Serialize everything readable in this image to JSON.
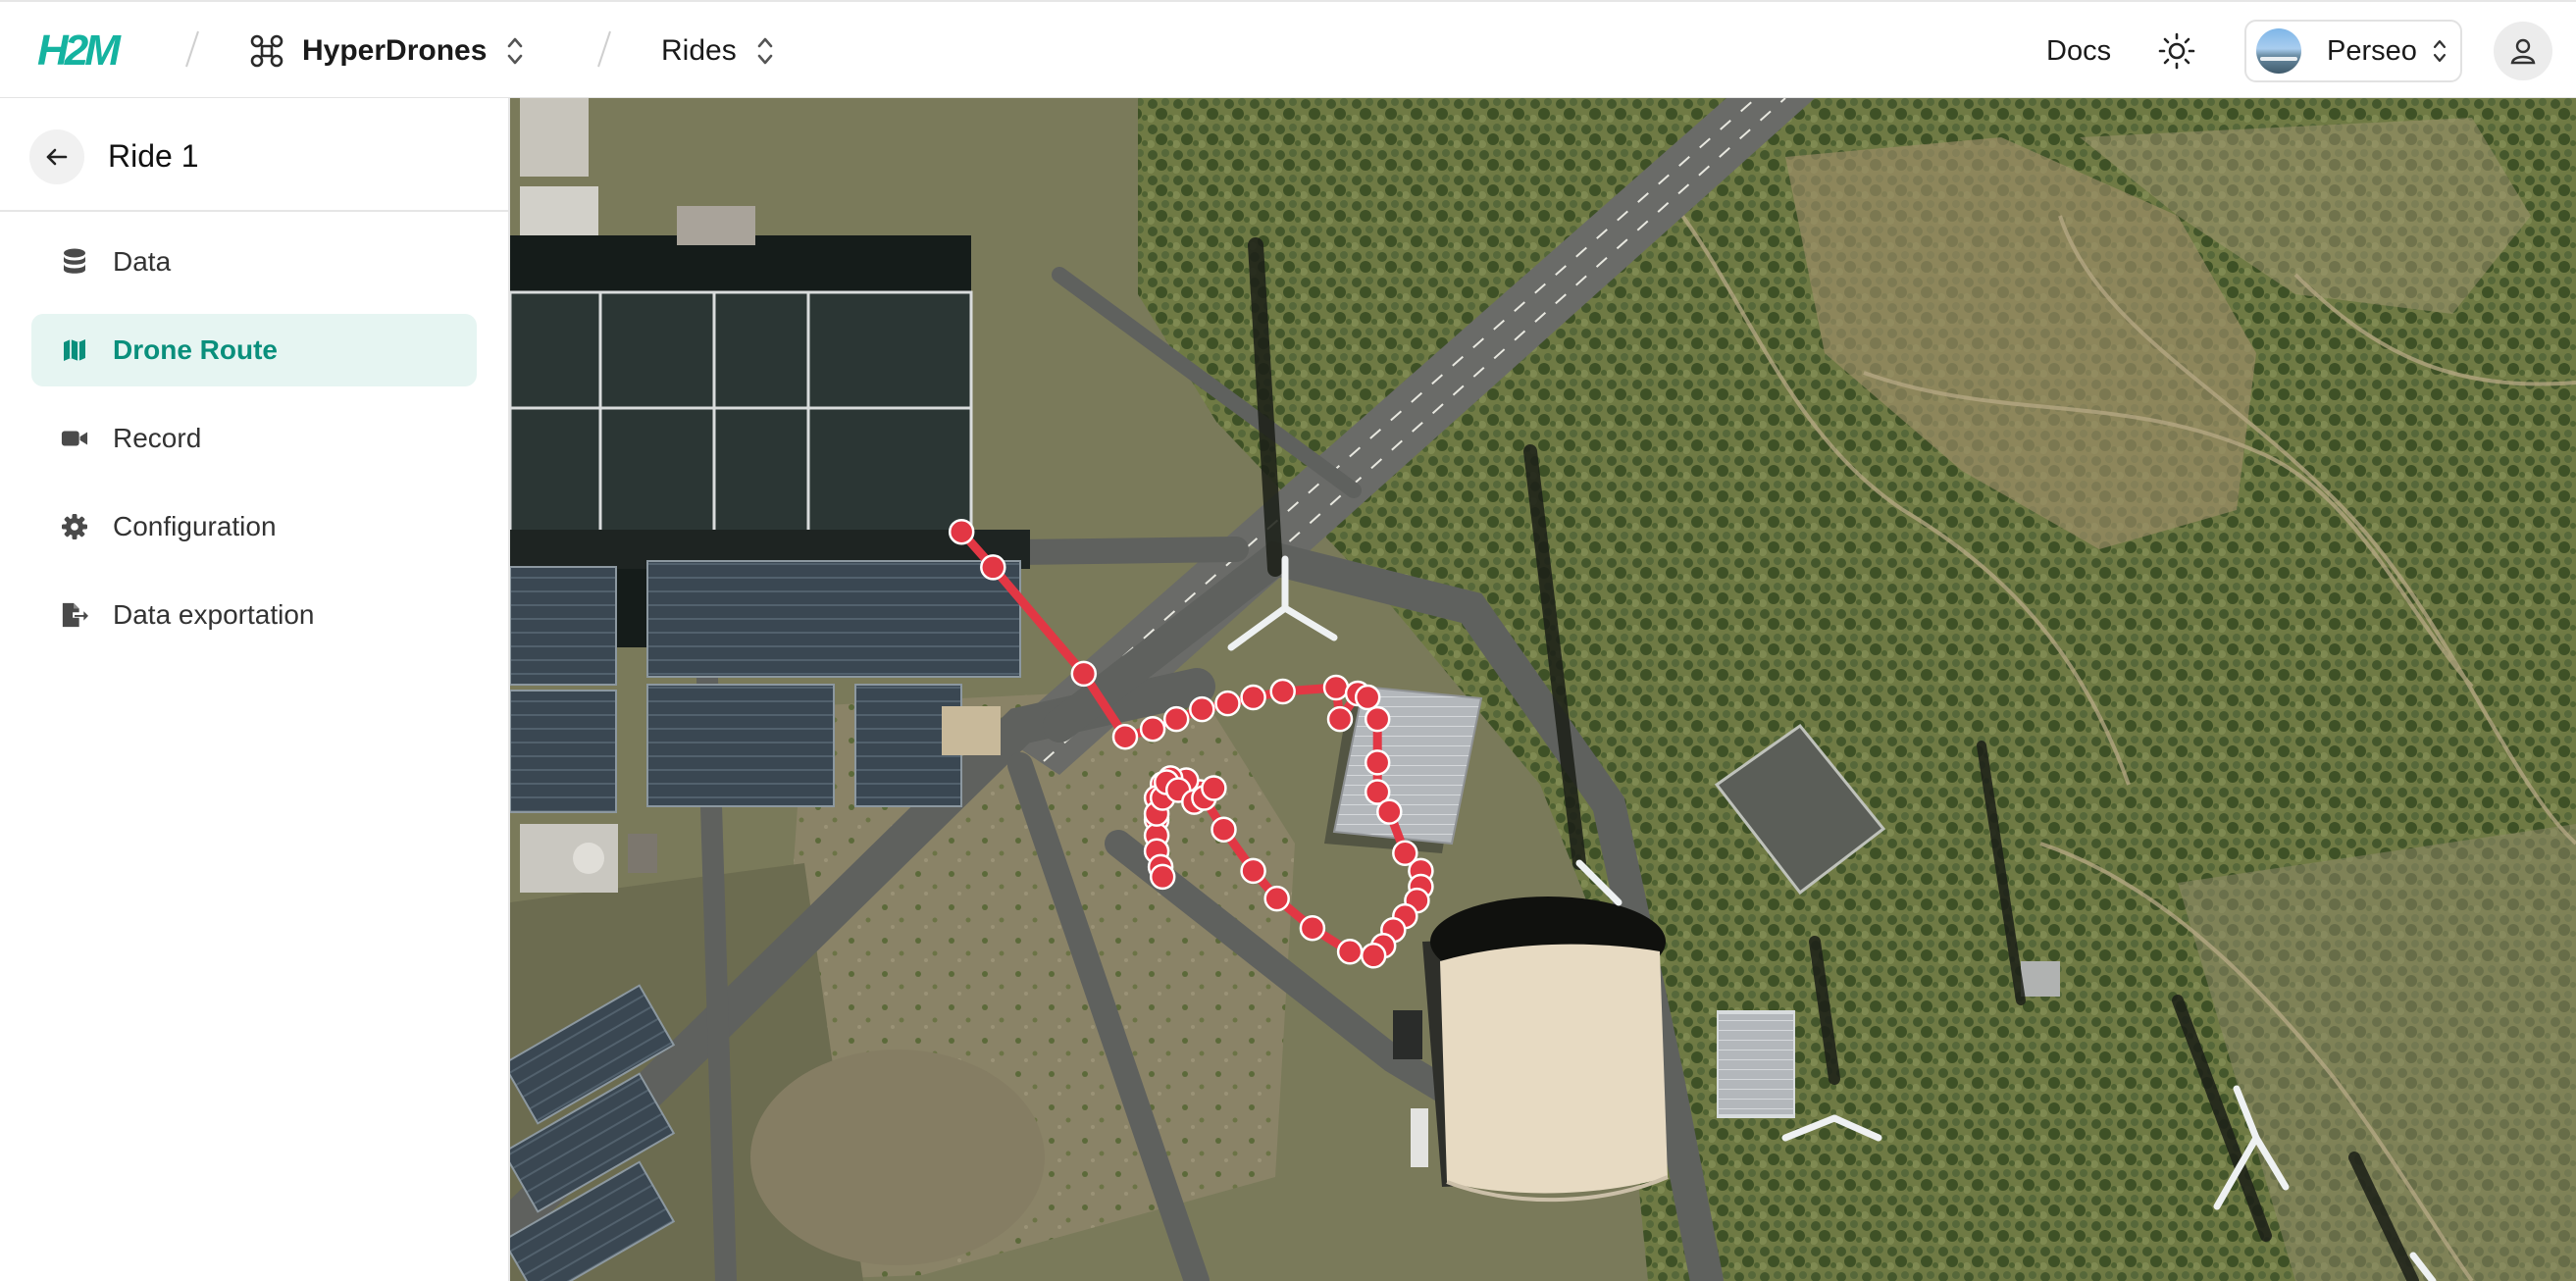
{
  "app": {
    "logo_text": "H2M",
    "brand_color": "#15b3a0"
  },
  "header": {
    "org": {
      "label": "HyperDrones",
      "icon": "drone-icon"
    },
    "section": {
      "label": "Rides"
    },
    "docs_label": "Docs",
    "theme_icon": "sun-icon",
    "project": {
      "label": "Perseo"
    },
    "user_icon": "user-icon"
  },
  "sidebar": {
    "title": "Ride 1",
    "back_icon": "arrow-left-icon",
    "active_color": "#0a8f7c",
    "items": [
      {
        "label": "Data",
        "icon": "database-icon",
        "active": false
      },
      {
        "label": "Drone Route",
        "icon": "map-icon",
        "active": true
      },
      {
        "label": "Record",
        "icon": "video-camera-icon",
        "active": false
      },
      {
        "label": "Configuration",
        "icon": "gear-icon",
        "active": false
      },
      {
        "label": "Data exportation",
        "icon": "file-export-icon",
        "active": false
      }
    ]
  },
  "map": {
    "type": "satellite",
    "route_color": "#e23744",
    "waypoint_count": 48
  }
}
